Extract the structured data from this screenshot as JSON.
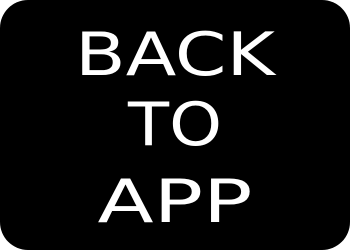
{
  "button": {
    "lines": [
      "BACK",
      "TO",
      "APP"
    ],
    "background_color": "#000000",
    "text_color": "#ffffff"
  }
}
